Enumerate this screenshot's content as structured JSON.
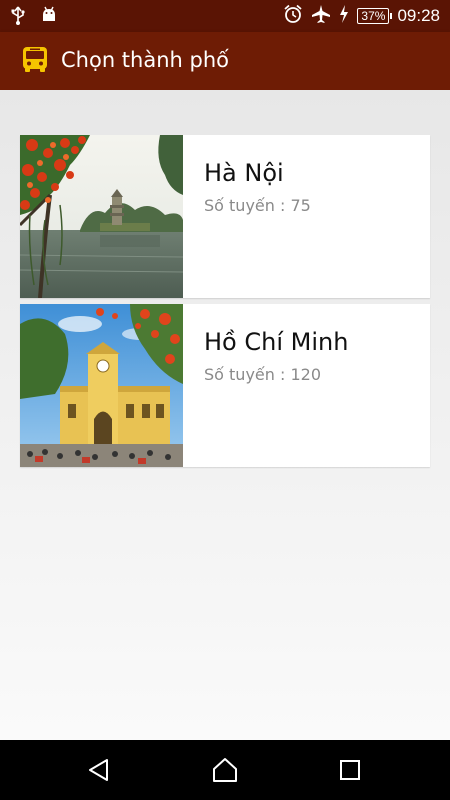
{
  "status_bar": {
    "time": "09:28",
    "battery": "37%",
    "icons": [
      "usb-icon",
      "android-debug-icon",
      "alarm-icon",
      "airplane-icon",
      "charging-icon",
      "battery-icon"
    ]
  },
  "app_bar": {
    "icon": "bus-icon",
    "title": "Chọn thành phố",
    "colors": {
      "primary": "#6e1c05",
      "primary_dark": "#5a1404",
      "icon_accent": "#f5c400"
    }
  },
  "cities": [
    {
      "name": "Hà Nội",
      "routes": "Số tuyến : 75",
      "image": "hoan-kiem-lake-photo"
    },
    {
      "name": "Hồ Chí Minh",
      "routes": "Số tuyến : 120",
      "image": "ben-thanh-market-photo"
    }
  ],
  "nav_bar": {
    "icons": [
      "back-icon",
      "home-icon",
      "recents-icon"
    ]
  }
}
